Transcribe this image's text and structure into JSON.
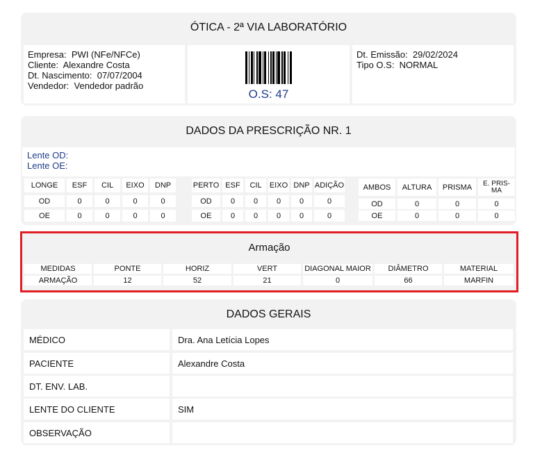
{
  "header": {
    "title": "ÓTICA - 2ª VIA LABORATÓRIO",
    "empresa_label": "Empresa:",
    "empresa": "PWI (NFe/NFCe)",
    "cliente_label": "Cliente:",
    "cliente": "Alexandre Costa",
    "nascimento_label": "Dt. Nascimento:",
    "nascimento": "07/07/2004",
    "vendedor_label": "Vendedor:",
    "vendedor": "Vendedor padrão",
    "os": "O.S: 47",
    "emissao_label": "Dt. Emissão:",
    "emissao": "29/02/2024",
    "tipo_label": "Tipo O.S:",
    "tipo": "NORMAL"
  },
  "prescricao": {
    "title": "DADOS DA PRESCRIÇÃO NR. 1",
    "lente_od": "Lente OD:",
    "lente_oe": "Lente OE:",
    "longe": {
      "headers": [
        "LONGE",
        "ESF",
        "CIL",
        "EIXO",
        "DNP"
      ],
      "rows": [
        [
          "OD",
          "0",
          "0",
          "0",
          "0"
        ],
        [
          "OE",
          "0",
          "0",
          "0",
          "0"
        ]
      ]
    },
    "perto": {
      "headers": [
        "PERTO",
        "ESF",
        "CIL",
        "EIXO",
        "DNP",
        "ADIÇÃO"
      ],
      "rows": [
        [
          "OD",
          "0",
          "0",
          "0",
          "0",
          "0"
        ],
        [
          "OE",
          "0",
          "0",
          "0",
          "0",
          "0"
        ]
      ]
    },
    "ambos": {
      "headers": [
        "AMBOS",
        "ALTURA",
        "PRISMA",
        "E. PRIS-\nMA"
      ],
      "rows": [
        [
          "OD",
          "0",
          "0",
          "0"
        ],
        [
          "OE",
          "0",
          "0",
          "0"
        ]
      ]
    }
  },
  "armacao": {
    "title": "Armação",
    "headers": [
      "MEDIDAS",
      "PONTE",
      "HORIZ",
      "VERT",
      "DIAGONAL MAIOR",
      "DIÂMETRO",
      "MATERIAL"
    ],
    "row": [
      "ARMAÇÃO",
      "12",
      "52",
      "21",
      "0",
      "66",
      "MARFIN"
    ]
  },
  "gerais": {
    "title": "DADOS GERAIS",
    "rows": [
      {
        "key": "MÉDICO",
        "value": "Dra. Ana Letícia Lopes"
      },
      {
        "key": "PACIENTE",
        "value": "Alexandre Costa"
      },
      {
        "key": "DT. ENV. LAB.",
        "value": ""
      },
      {
        "key": "LENTE DO CLIENTE",
        "value": "SIM"
      },
      {
        "key": "OBSERVAÇÃO",
        "value": ""
      }
    ]
  }
}
